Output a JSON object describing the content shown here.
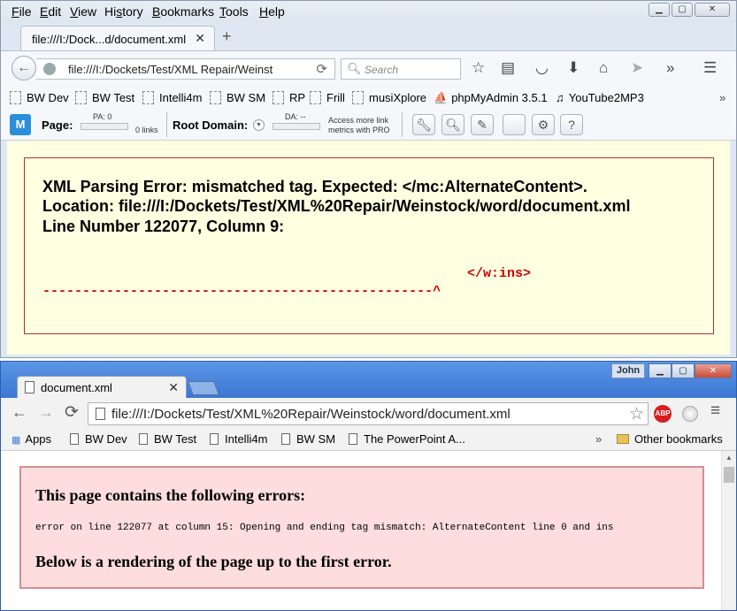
{
  "firefox": {
    "menu": [
      "File",
      "Edit",
      "View",
      "History",
      "Bookmarks",
      "Tools",
      "Help"
    ],
    "menu_hotkeys": [
      "F",
      "E",
      "V",
      "s",
      "B",
      "T",
      "H"
    ],
    "tab_title": "file:///I:/Dock...d/document.xml",
    "url": "file:///I:/Dockets/Test/XML Repair/Weinst",
    "search_placeholder": "Search",
    "bookmarks": [
      "BW Dev",
      "BW Test",
      "Intelli4m",
      "BW SM",
      "RP",
      "Frill",
      "musiXplore",
      "phpMyAdmin 3.5.1",
      "YouTube2MP3"
    ],
    "moz": {
      "page_label": "Page:",
      "pa": "PA: 0",
      "links": "0 links",
      "root_label": "Root Domain:",
      "da": "DA: --",
      "promo_line1": "Access more link",
      "promo_line2": "metrics with PRO"
    },
    "error": {
      "line1": "XML Parsing Error: mismatched tag. Expected: </mc:AlternateContent>.",
      "line2": "Location: file:///I:/Dockets/Test/XML%20Repair/Weinstock/word/document.xml",
      "line3": "Line Number 122077, Column 9:",
      "source": "</w:ins>",
      "pointer": "-------------------------------------------------^"
    }
  },
  "chrome": {
    "user": "John",
    "tab_title": "document.xml",
    "url": "file:///I:/Dockets/Test/XML%20Repair/Weinstock/word/document.xml",
    "abp": "ABP",
    "bookmarks": [
      "Apps",
      "BW Dev",
      "BW Test",
      "Intelli4m",
      "BW SM",
      "The PowerPoint A..."
    ],
    "overflow": "»",
    "other_bookmarks": "Other bookmarks",
    "error": {
      "heading": "This page contains the following errors:",
      "detail": "error on line 122077 at column 15: Opening and ending tag mismatch: AlternateContent line 0 and ins",
      "footer": "Below is a rendering of the page up to the first error."
    }
  }
}
